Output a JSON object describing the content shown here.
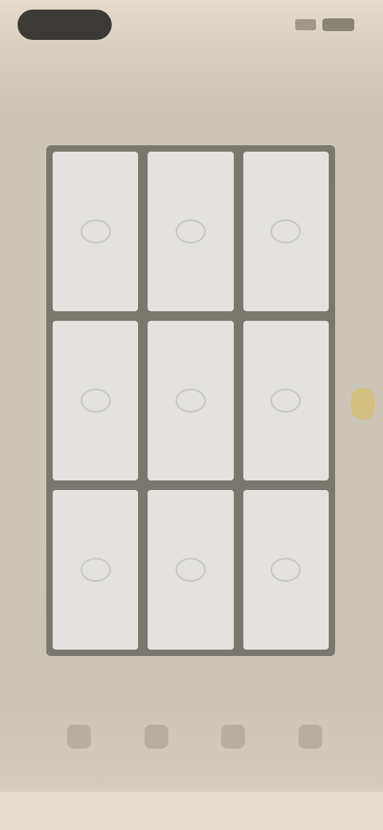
{
  "status_bar": {
    "time_pill": "",
    "signal_icon": "signal-icon",
    "battery_icon": "battery-icon"
  },
  "header": {
    "subtitle": "",
    "title": ""
  },
  "board": {
    "cells": [
      {
        "mark": ""
      },
      {
        "mark": ""
      },
      {
        "mark": ""
      },
      {
        "mark": ""
      },
      {
        "mark": ""
      },
      {
        "mark": ""
      },
      {
        "mark": ""
      },
      {
        "mark": ""
      },
      {
        "mark": ""
      }
    ]
  },
  "side_handle": {
    "color": "#d3bf7f"
  },
  "toolbar": {
    "items": [
      {
        "label": "",
        "icon": "tool-1-icon"
      },
      {
        "label": "",
        "icon": "tool-2-icon"
      },
      {
        "label": "",
        "icon": "tool-3-icon"
      },
      {
        "label": "",
        "icon": "tool-4-icon"
      }
    ]
  },
  "colors": {
    "background": "#cdc5b7",
    "grid_frame": "#7a776f",
    "cell": "#e3e2df",
    "accent": "#d3bf7f"
  }
}
